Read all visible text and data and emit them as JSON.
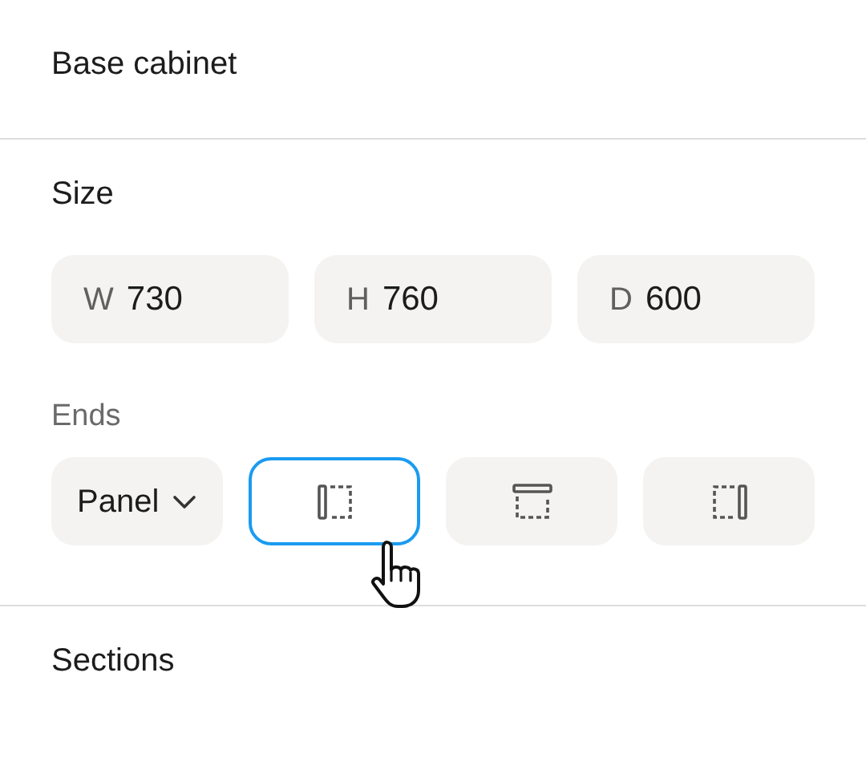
{
  "header": {
    "title": "Base cabinet"
  },
  "size": {
    "title": "Size",
    "fields": [
      {
        "label": "W",
        "value": "730"
      },
      {
        "label": "H",
        "value": "760"
      },
      {
        "label": "D",
        "value": "600"
      }
    ]
  },
  "ends": {
    "title": "Ends",
    "dropdown": {
      "value": "Panel"
    },
    "options": [
      {
        "kind": "left",
        "selected": true
      },
      {
        "kind": "top",
        "selected": false
      },
      {
        "kind": "right",
        "selected": false
      }
    ]
  },
  "sections": {
    "title": "Sections"
  }
}
